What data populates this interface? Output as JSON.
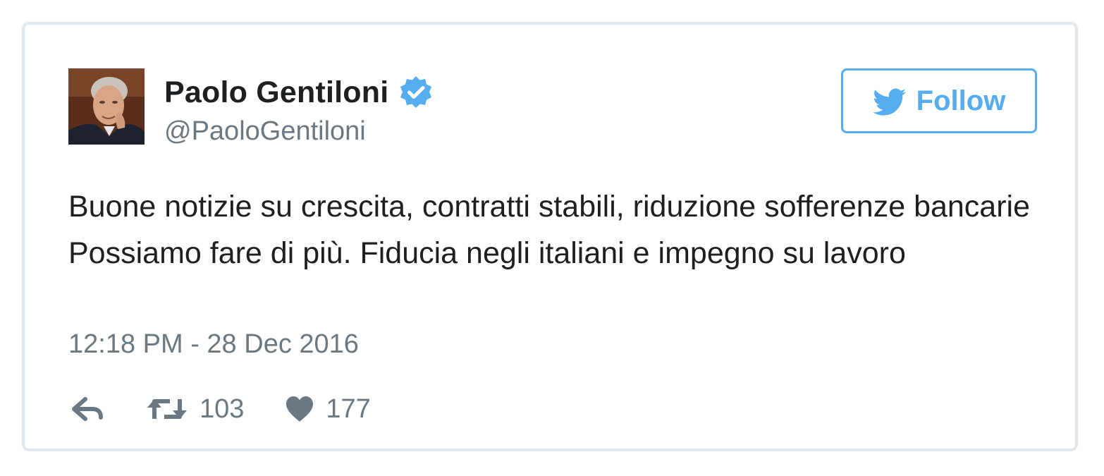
{
  "tweet": {
    "author": {
      "name": "Paolo Gentiloni",
      "handle": "@PaoloGentiloni",
      "verified": true,
      "avatar_icon": "profile-photo"
    },
    "follow_label": "Follow",
    "text": "Buone notizie su crescita, contratti stabili, riduzione sofferenze bancarie Possiamo fare di più. Fiducia negli italiani e impegno su lavoro",
    "timestamp": "12:18 PM - 28 Dec 2016",
    "actions": {
      "reply_icon": "reply-icon",
      "retweet_icon": "retweet-icon",
      "retweet_count": "103",
      "like_icon": "heart-icon",
      "like_count": "177"
    }
  },
  "colors": {
    "accent": "#55acee",
    "verified": "#55acee",
    "text": "#1c2022",
    "muted": "#697882",
    "border": "#e1e8ed"
  }
}
